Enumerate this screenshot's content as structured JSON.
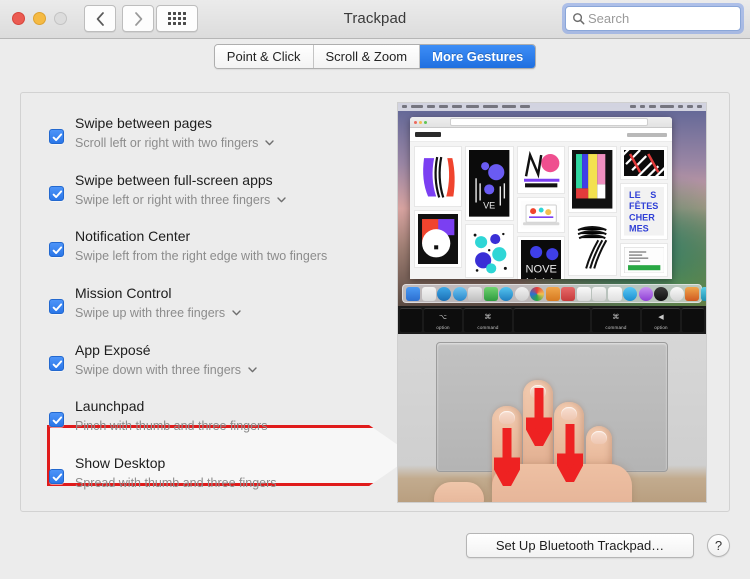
{
  "window": {
    "title": "Trackpad",
    "traffic_lights": [
      "close",
      "minimize",
      "zoom"
    ],
    "nav_back_icon": "chevron-left-icon",
    "nav_forward_icon": "chevron-right-icon",
    "show_all_icon": "grid-dots-icon"
  },
  "search": {
    "placeholder": "Search",
    "value": "",
    "icon": "search-icon",
    "focused": true,
    "focus_ring_color": "#6b8ce3"
  },
  "tabs": [
    {
      "label": "Point & Click",
      "active": false
    },
    {
      "label": "Scroll & Zoom",
      "active": false
    },
    {
      "label": "More Gestures",
      "active": true
    }
  ],
  "accent_color": "#2a76e8",
  "highlight_color": "#e01b1b",
  "gestures": [
    {
      "title": "Swipe between pages",
      "subtitle": "Scroll left or right with two fingers",
      "checked": true,
      "has_popup": true,
      "highlighted": false
    },
    {
      "title": "Swipe between full-screen apps",
      "subtitle": "Swipe left or right with three fingers",
      "checked": true,
      "has_popup": true,
      "highlighted": false
    },
    {
      "title": "Notification Center",
      "subtitle": "Swipe left from the right edge with two fingers",
      "checked": true,
      "has_popup": false,
      "highlighted": false
    },
    {
      "title": "Mission Control",
      "subtitle": "Swipe up with three fingers",
      "checked": true,
      "has_popup": true,
      "highlighted": false
    },
    {
      "title": "App Exposé",
      "subtitle": "Swipe down with three fingers",
      "checked": true,
      "has_popup": true,
      "highlighted": true
    },
    {
      "title": "Launchpad",
      "subtitle": "Pinch with thumb and three fingers",
      "checked": true,
      "has_popup": false,
      "highlighted": false
    },
    {
      "title": "Show Desktop",
      "subtitle": "Spread with thumb and three fingers",
      "checked": true,
      "has_popup": false,
      "highlighted": false
    }
  ],
  "preview": {
    "description": "Demonstration photo: a Mac screen showing a browser window of colorful poster thumbnails above a Dock, with a hand performing a three-finger downward swipe on the trackpad",
    "arrows": 3,
    "arrow_color": "#ee2222",
    "arrow_direction": "down",
    "keys": [
      {
        "label": "",
        "glyph": ""
      },
      {
        "label": "option",
        "glyph": "⌥"
      },
      {
        "label": "command",
        "glyph": "⌘"
      },
      {
        "label": "",
        "glyph": ""
      },
      {
        "label": "command",
        "glyph": "⌘"
      },
      {
        "label": "option",
        "glyph": "⌥"
      },
      {
        "label": "",
        "glyph": ""
      }
    ]
  },
  "footer": {
    "setup_button_label": "Set Up Bluetooth Trackpad…",
    "help_button_label": "?"
  }
}
